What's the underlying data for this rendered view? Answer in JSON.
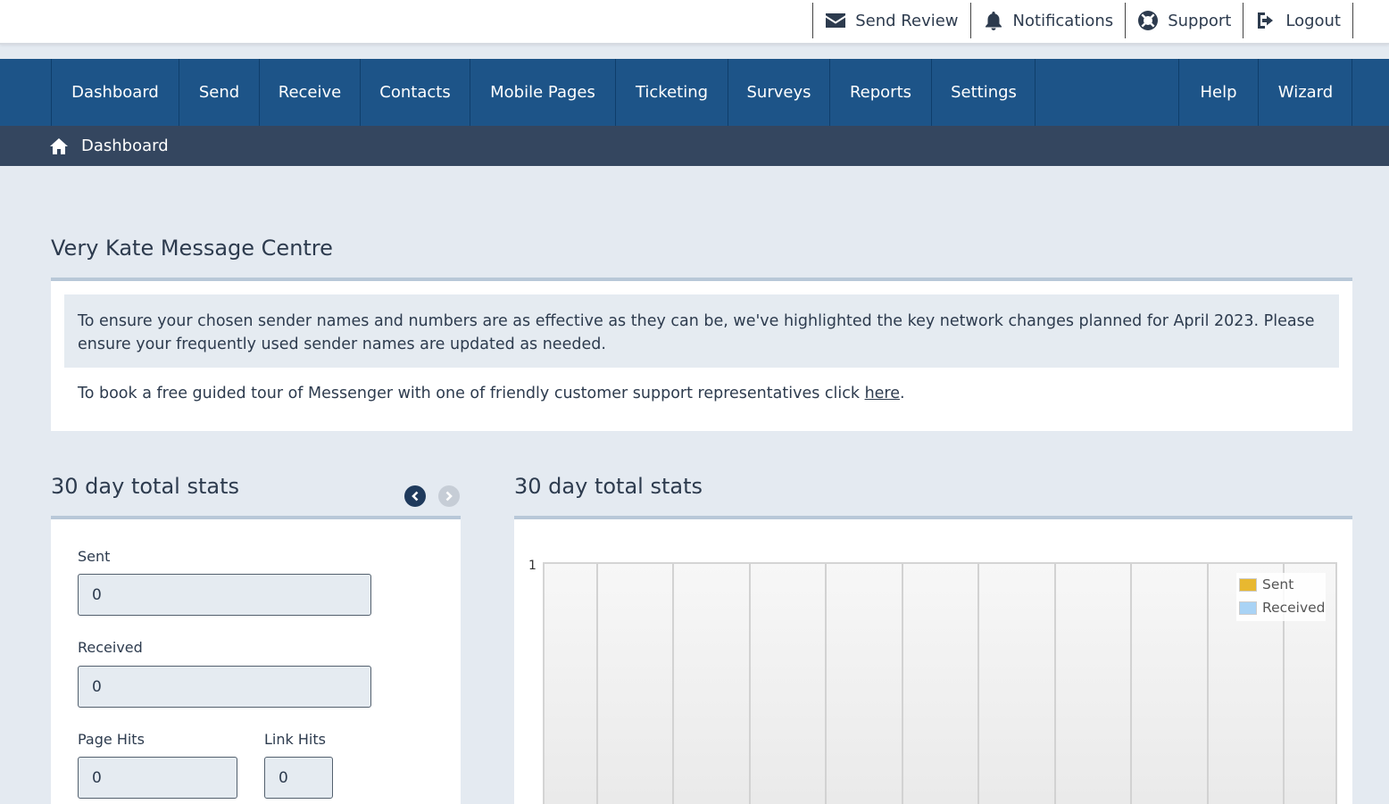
{
  "topbar": {
    "links": [
      {
        "label": "Send Review",
        "icon": "envelope-icon"
      },
      {
        "label": "Notifications",
        "icon": "bell-icon"
      },
      {
        "label": "Support",
        "icon": "lifebuoy-icon"
      },
      {
        "label": "Logout",
        "icon": "sign-out-icon"
      }
    ]
  },
  "nav": {
    "items": [
      "Dashboard",
      "Send",
      "Receive",
      "Contacts",
      "Mobile Pages",
      "Ticketing",
      "Surveys",
      "Reports",
      "Settings"
    ],
    "right_items": [
      "Help",
      "Wizard"
    ]
  },
  "breadcrumb": {
    "icon": "home-icon",
    "label": "Dashboard"
  },
  "message_centre": {
    "title": "Very Kate Message Centre",
    "notice": "To ensure your chosen sender names and numbers are as effective as they can be, we've highlighted the key network changes planned for April 2023. Please ensure your frequently used sender names are updated as needed.",
    "tour_text": "To book a free guided tour of Messenger with one of friendly customer support representatives click ",
    "tour_link": "here",
    "tour_end": "."
  },
  "stats": {
    "title": "30 day total stats",
    "prev_icon": "chevron-left-icon",
    "next_icon": "chevron-right-icon",
    "sent_label": "Sent",
    "sent_value": "0",
    "received_label": "Received",
    "received_value": "0",
    "page_hits_label": "Page Hits",
    "page_hits_value": "0",
    "link_hits_label": "Link Hits",
    "link_hits_value": "0"
  },
  "chart": {
    "title": "30 day total stats",
    "colors": {
      "sent": "#e8b830",
      "received": "#a9d3f5"
    }
  },
  "chart_data": {
    "type": "bar",
    "title": "30 day total stats",
    "y_ticks": [
      "1"
    ],
    "ylim": [
      0,
      1
    ],
    "legend_position": "top-right",
    "grid": true,
    "series": [
      {
        "name": "Sent",
        "values": []
      },
      {
        "name": "Received",
        "values": []
      }
    ]
  }
}
